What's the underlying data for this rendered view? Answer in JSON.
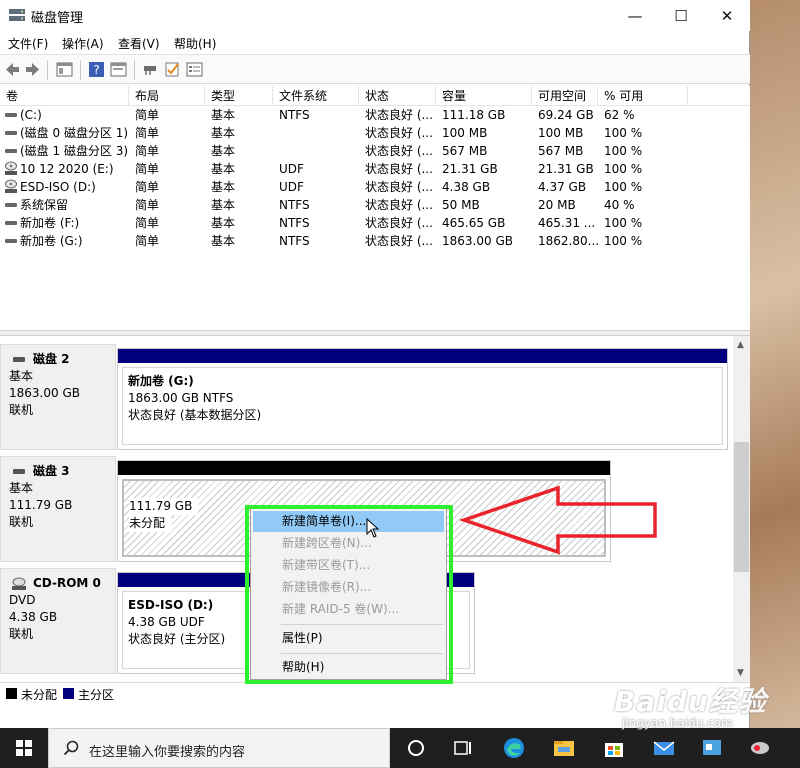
{
  "window": {
    "title": "磁盘管理",
    "controls": {
      "minimize": "—",
      "maximize": "☐",
      "close": "✕"
    }
  },
  "menu": [
    "文件(F)",
    "操作(A)",
    "查看(V)",
    "帮助(H)"
  ],
  "table": {
    "columns": [
      "卷",
      "布局",
      "类型",
      "文件系统",
      "状态",
      "容量",
      "可用空间",
      "% 可用"
    ],
    "rows": [
      {
        "vol": "(C:)",
        "layout": "简单",
        "type": "基本",
        "fs": "NTFS",
        "status": "状态良好 (...",
        "capacity": "111.18 GB",
        "free": "69.24 GB",
        "pct": "62 %",
        "icon": "drive-icon"
      },
      {
        "vol": "(磁盘 0 磁盘分区 1)",
        "layout": "简单",
        "type": "基本",
        "fs": "",
        "status": "状态良好 (...",
        "capacity": "100 MB",
        "free": "100 MB",
        "pct": "100 %",
        "icon": "drive-icon"
      },
      {
        "vol": "(磁盘 1 磁盘分区 3)",
        "layout": "简单",
        "type": "基本",
        "fs": "",
        "status": "状态良好 (...",
        "capacity": "567 MB",
        "free": "567 MB",
        "pct": "100 %",
        "icon": "drive-icon"
      },
      {
        "vol": "10 12 2020 (E:)",
        "layout": "简单",
        "type": "基本",
        "fs": "UDF",
        "status": "状态良好 (...",
        "capacity": "21.31 GB",
        "free": "21.31 GB",
        "pct": "100 %",
        "icon": "cd-icon"
      },
      {
        "vol": "ESD-ISO (D:)",
        "layout": "简单",
        "type": "基本",
        "fs": "UDF",
        "status": "状态良好 (...",
        "capacity": "4.38 GB",
        "free": "4.37 GB",
        "pct": "100 %",
        "icon": "cd-icon"
      },
      {
        "vol": "系统保留",
        "layout": "简单",
        "type": "基本",
        "fs": "NTFS",
        "status": "状态良好 (...",
        "capacity": "50 MB",
        "free": "20 MB",
        "pct": "40 %",
        "icon": "drive-icon"
      },
      {
        "vol": "新加卷 (F:)",
        "layout": "简单",
        "type": "基本",
        "fs": "NTFS",
        "status": "状态良好 (...",
        "capacity": "465.65 GB",
        "free": "465.31 ...",
        "pct": "100 %",
        "icon": "drive-icon"
      },
      {
        "vol": "新加卷 (G:)",
        "layout": "简单",
        "type": "基本",
        "fs": "NTFS",
        "status": "状态良好 (...",
        "capacity": "1863.00 GB",
        "free": "1862.80...",
        "pct": "100 %",
        "icon": "drive-icon"
      }
    ]
  },
  "disks": [
    {
      "name": "磁盘 2",
      "kind": "基本",
      "size": "1863.00 GB",
      "state": "联机",
      "partition": {
        "title": "新加卷  (G:)",
        "line2": "1863.00 GB NTFS",
        "line3": "状态良好 (基本数据分区)"
      }
    },
    {
      "name": "磁盘 3",
      "kind": "基本",
      "size": "111.79 GB",
      "state": "联机",
      "partition": {
        "title": "",
        "line2": "111.79 GB",
        "line3": "未分配"
      }
    },
    {
      "name": "CD-ROM 0",
      "kind": "DVD",
      "size": "4.38 GB",
      "state": "联机",
      "partition": {
        "title": "ESD-ISO  (D:)",
        "line2": "4.38 GB UDF",
        "line3": "状态良好 (主分区)"
      }
    }
  ],
  "context_menu": {
    "items": [
      "新建简单卷(I)...",
      "新建跨区卷(N)...",
      "新建带区卷(T)...",
      "新建镜像卷(R)...",
      "新建 RAID-5 卷(W)...",
      "属性(P)",
      "帮助(H)"
    ]
  },
  "legend": [
    {
      "label": "未分配",
      "color": "#000000"
    },
    {
      "label": "主分区",
      "color": "#00007f"
    }
  ],
  "taskbar": {
    "search_placeholder": "在这里输入你要搜索的内容"
  },
  "watermark": {
    "logo": "Baidu经验",
    "url": "jingyan.baidu.com"
  },
  "colors": {
    "primary_partition": "#00007f",
    "unallocated": "#000000",
    "highlight": "#91c9f7",
    "green_box": "#2ef02e",
    "arrow": "#e8232b"
  }
}
